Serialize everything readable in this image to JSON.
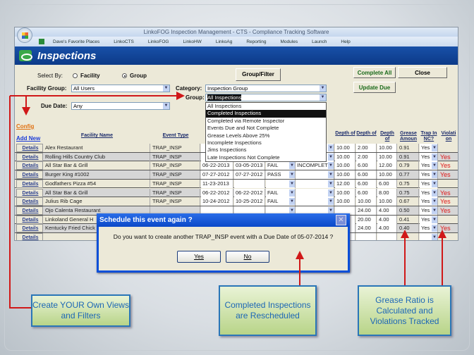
{
  "window": {
    "title": "LinkoFOG Inspection Management - CTS - Compliance Tracking Software",
    "menu": [
      "Dave's Favorite Places",
      "LinkoCTS",
      "LinkoFOG",
      "LinkoHW",
      "LinkoAg",
      "Reporting",
      "Modules",
      "Launch",
      "Help"
    ]
  },
  "page": {
    "title": "Inspections"
  },
  "filters": {
    "select_by_label": "Select By:",
    "option_facility": "Facility",
    "option_group": "Group",
    "selected": "Group",
    "facility_group_label": "Facility Group:",
    "facility_group_value": "All Users",
    "due_date_label": "Due Date:",
    "due_date_value": "Any",
    "category_label": "Category:",
    "category_value": "Inspection Group",
    "group_label": "Group:",
    "group_value": "All Inspections",
    "group_options": [
      "All Inspections",
      "Completed Inspections",
      "Completed via Remote Inspector",
      "Events Due and Not Complete",
      "Grease Levels Above 25%",
      "Incomplete Inspections",
      "Jims Inspections",
      "Late Inspections Not Complete"
    ],
    "highlighted_option": "Completed Inspections"
  },
  "buttons": {
    "group_filter": "Group/Filter",
    "complete_all": "Complete All",
    "close": "Close",
    "update_due": "Update Due"
  },
  "links": {
    "config": "Config",
    "add_new": "Add New"
  },
  "table": {
    "headers": [
      "Facility Name",
      "Event Type",
      "Depth of",
      "Depth of",
      "Depth of",
      "Grease Amoun",
      "Trap In NC?",
      "Violati on"
    ],
    "details_label": "Details",
    "rows": [
      [
        "Alex Restaurant",
        "TRAP_INSP",
        "",
        "",
        "",
        "",
        "10.00",
        "2.00",
        "10.00",
        "0.91",
        "Yes",
        ""
      ],
      [
        "Rolling Hills Country Club",
        "TRAP_INSP",
        "",
        "",
        "",
        "",
        "10.00",
        "2.00",
        "10.00",
        "0.91",
        "Yes",
        "Yes"
      ],
      [
        "All Star Bar & Grill",
        "TRAP_INSP",
        "06-22-2013",
        "03-05-2013",
        "FAIL",
        "INCOMPLET",
        "10.00",
        "6.00",
        "12.00",
        "0.79",
        "Yes",
        "Yes"
      ],
      [
        "Burger King  #1002",
        "TRAP_INSP",
        "07-27-2012",
        "07-27-2012",
        "PASS",
        "",
        "10.00",
        "6.00",
        "10.00",
        "0.77",
        "Yes",
        "Yes"
      ],
      [
        "Godfathers Pizza  #54",
        "TRAP_INSP",
        "11-23-2013",
        "",
        "",
        "",
        "12.00",
        "6.00",
        "6.00",
        "0.75",
        "Yes",
        ""
      ],
      [
        "All Star Bar & Grill",
        "TRAP_INSP",
        "06-22-2012",
        "06-22-2012",
        "FAIL",
        "",
        "10.00",
        "6.00",
        "8.00",
        "0.75",
        "Yes",
        "Yes"
      ],
      [
        "Julius Rib Cage",
        "TRAP_INSP",
        "10-24-2012",
        "10-25-2012",
        "FAIL",
        "",
        "10.00",
        "10.00",
        "10.00",
        "0.67",
        "Yes",
        "Yes"
      ],
      [
        "Ojo Calenta Restaurant",
        "",
        "",
        "",
        "",
        "",
        "",
        "24.00",
        "4.00",
        "0.50",
        "Yes",
        "Yes"
      ],
      [
        "Linkoland General H",
        "",
        "",
        "",
        "",
        "",
        "",
        "20.00",
        "4.00",
        "0.41",
        "Yes",
        ""
      ],
      [
        "Kentucky Fried Chick",
        "",
        "",
        "",
        "",
        "",
        "",
        "24.00",
        "4.00",
        "0.40",
        "Yes",
        "Yes"
      ],
      [
        "",
        "",
        "",
        "",
        "",
        "",
        "",
        "",
        "",
        "",
        "",
        ""
      ]
    ]
  },
  "dialog": {
    "title": "Schedule this event again ?",
    "message": "Do you want to create another TRAP_INSP event with a Due Date of 05-07-2014 ?",
    "yes": "Yes",
    "no": "No"
  },
  "callouts": {
    "left": "Create YOUR Own Views and Filters",
    "middle": "Completed Inspections are Rescheduled",
    "right": "Grease Ratio is Calculated and Violations Tracked"
  },
  "colors": {
    "banner": "#0c3a88",
    "violation": "#e01818",
    "annotation_arrow": "#d01818",
    "callout_text": "#1d67b6"
  }
}
